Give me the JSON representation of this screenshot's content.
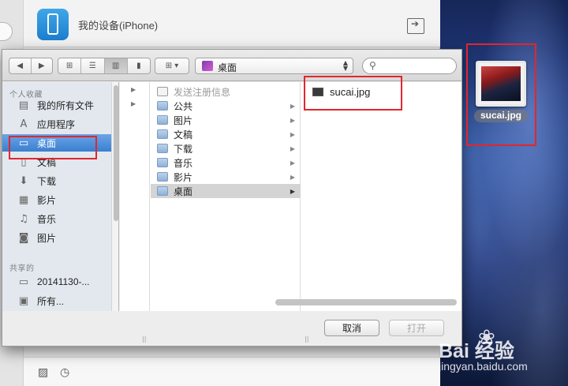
{
  "back_window": {
    "device_title": "我的设备(iPhone)",
    "export_icon": "export-icon",
    "bottom_icons": [
      "photo-icon",
      "clock-icon"
    ]
  },
  "dialog": {
    "toolbar": {
      "nav_icons": [
        "back-arrow-icon",
        "forward-arrow-icon"
      ],
      "view_icons": [
        "icon-view-icon",
        "list-view-icon",
        "column-view-icon",
        "coverflow-view-icon"
      ],
      "arrange_icon": "arrange-icon",
      "path_label": "桌面",
      "search_placeholder": ""
    },
    "sidebar": {
      "favorites_header": "个人收藏",
      "favorites": [
        {
          "label": "我的所有文件",
          "icon": "all-files-icon",
          "glyph": "▤"
        },
        {
          "label": "应用程序",
          "icon": "applications-icon",
          "glyph": "A"
        },
        {
          "label": "桌面",
          "icon": "desktop-icon",
          "glyph": "▭",
          "selected": true
        },
        {
          "label": "文稿",
          "icon": "documents-icon",
          "glyph": "▯"
        },
        {
          "label": "下载",
          "icon": "downloads-icon",
          "glyph": "⬇"
        },
        {
          "label": "影片",
          "icon": "movies-icon",
          "glyph": "▦"
        },
        {
          "label": "音乐",
          "icon": "music-icon",
          "glyph": "♫"
        },
        {
          "label": "图片",
          "icon": "pictures-icon",
          "glyph": "◙"
        }
      ],
      "shared_header": "共享的",
      "shared": [
        {
          "label": "20141130-...",
          "icon": "computer-icon",
          "glyph": "▭"
        },
        {
          "label": "所有...",
          "icon": "network-icon",
          "glyph": "▣"
        }
      ]
    },
    "column1": [
      {
        "label": "发送注册信息",
        "dim": true,
        "doc": true
      },
      {
        "label": "公共"
      },
      {
        "label": "图片"
      },
      {
        "label": "文稿"
      },
      {
        "label": "下载"
      },
      {
        "label": "音乐"
      },
      {
        "label": "影片"
      },
      {
        "label": "桌面",
        "selected": true
      }
    ],
    "column2": [
      {
        "label": "sucai.jpg"
      }
    ],
    "buttons": {
      "cancel": "取消",
      "open": "打开"
    }
  },
  "desktop": {
    "file_label": "sucai.jpg"
  },
  "watermark": {
    "main": "Bai 经验",
    "sub": "jingyan.baidu.com"
  },
  "colors": {
    "selection_blue": "#3b7fd0",
    "annotation_red": "#e2262d",
    "desktop_dark": "#0d1838"
  }
}
